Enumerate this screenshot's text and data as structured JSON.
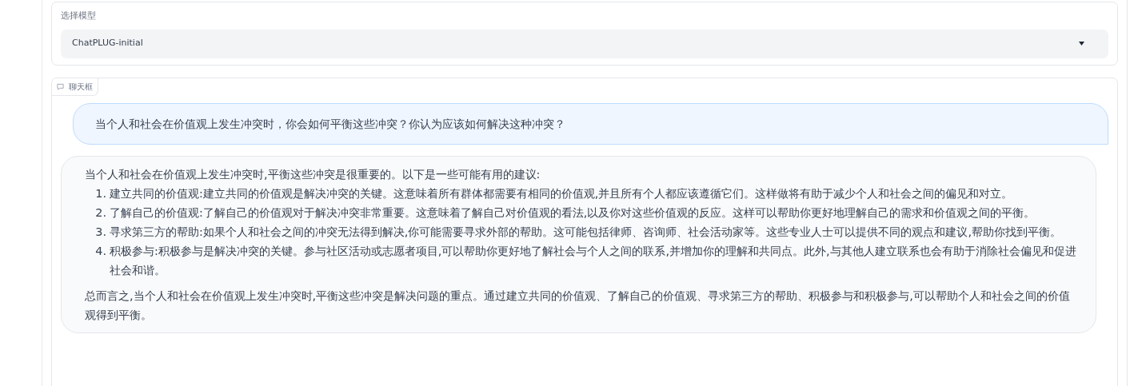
{
  "model_select": {
    "label": "选择模型",
    "value": "ChatPLUG-initial"
  },
  "chat": {
    "label": "聊天框",
    "messages": [
      {
        "kind": "user",
        "text": "当个人和社会在价值观上发生冲突时，你会如何平衡这些冲突？你认为应该如何解决这种冲突？"
      },
      {
        "kind": "bot",
        "intro": "当个人和社会在价值观上发生冲突时,平衡这些冲突是很重要的。以下是一些可能有用的建议:",
        "items": [
          {
            "number": "1.",
            "text": "建立共同的价值观:建立共同的价值观是解决冲突的关键。这意味着所有群体都需要有相同的价值观,并且所有个人都应该遵循它们。这样做将有助于减少个人和社会之间的偏见和对立。"
          },
          {
            "number": "2.",
            "text": "了解自己的价值观:了解自己的价值观对于解决冲突非常重要。这意味着了解自己对价值观的看法,以及你对这些价值观的反应。这样可以帮助你更好地理解自己的需求和价值观之间的平衡。"
          },
          {
            "number": "3.",
            "text": "寻求第三方的帮助:如果个人和社会之间的冲突无法得到解决,你可能需要寻求外部的帮助。这可能包括律师、咨询师、社会活动家等。这些专业人士可以提供不同的观点和建议,帮助你找到平衡。"
          },
          {
            "number": "4.",
            "text": "积极参与:积极参与是解决冲突的关键。参与社区活动或志愿者项目,可以帮助你更好地了解社会与个人之间的联系,并增加你的理解和共同点。此外,与其他人建立联系也会有助于消除社会偏见和促进社会和谐。"
          }
        ],
        "conclusion": "总而言之,当个人和社会在价值观上发生冲突时,平衡这些冲突是解决问题的重点。通过建立共同的价值观、了解自己的价值观、寻求第三方的帮助、积极参与和积极参与,可以帮助个人和社会之间的价值观得到平衡。"
      }
    ]
  }
}
